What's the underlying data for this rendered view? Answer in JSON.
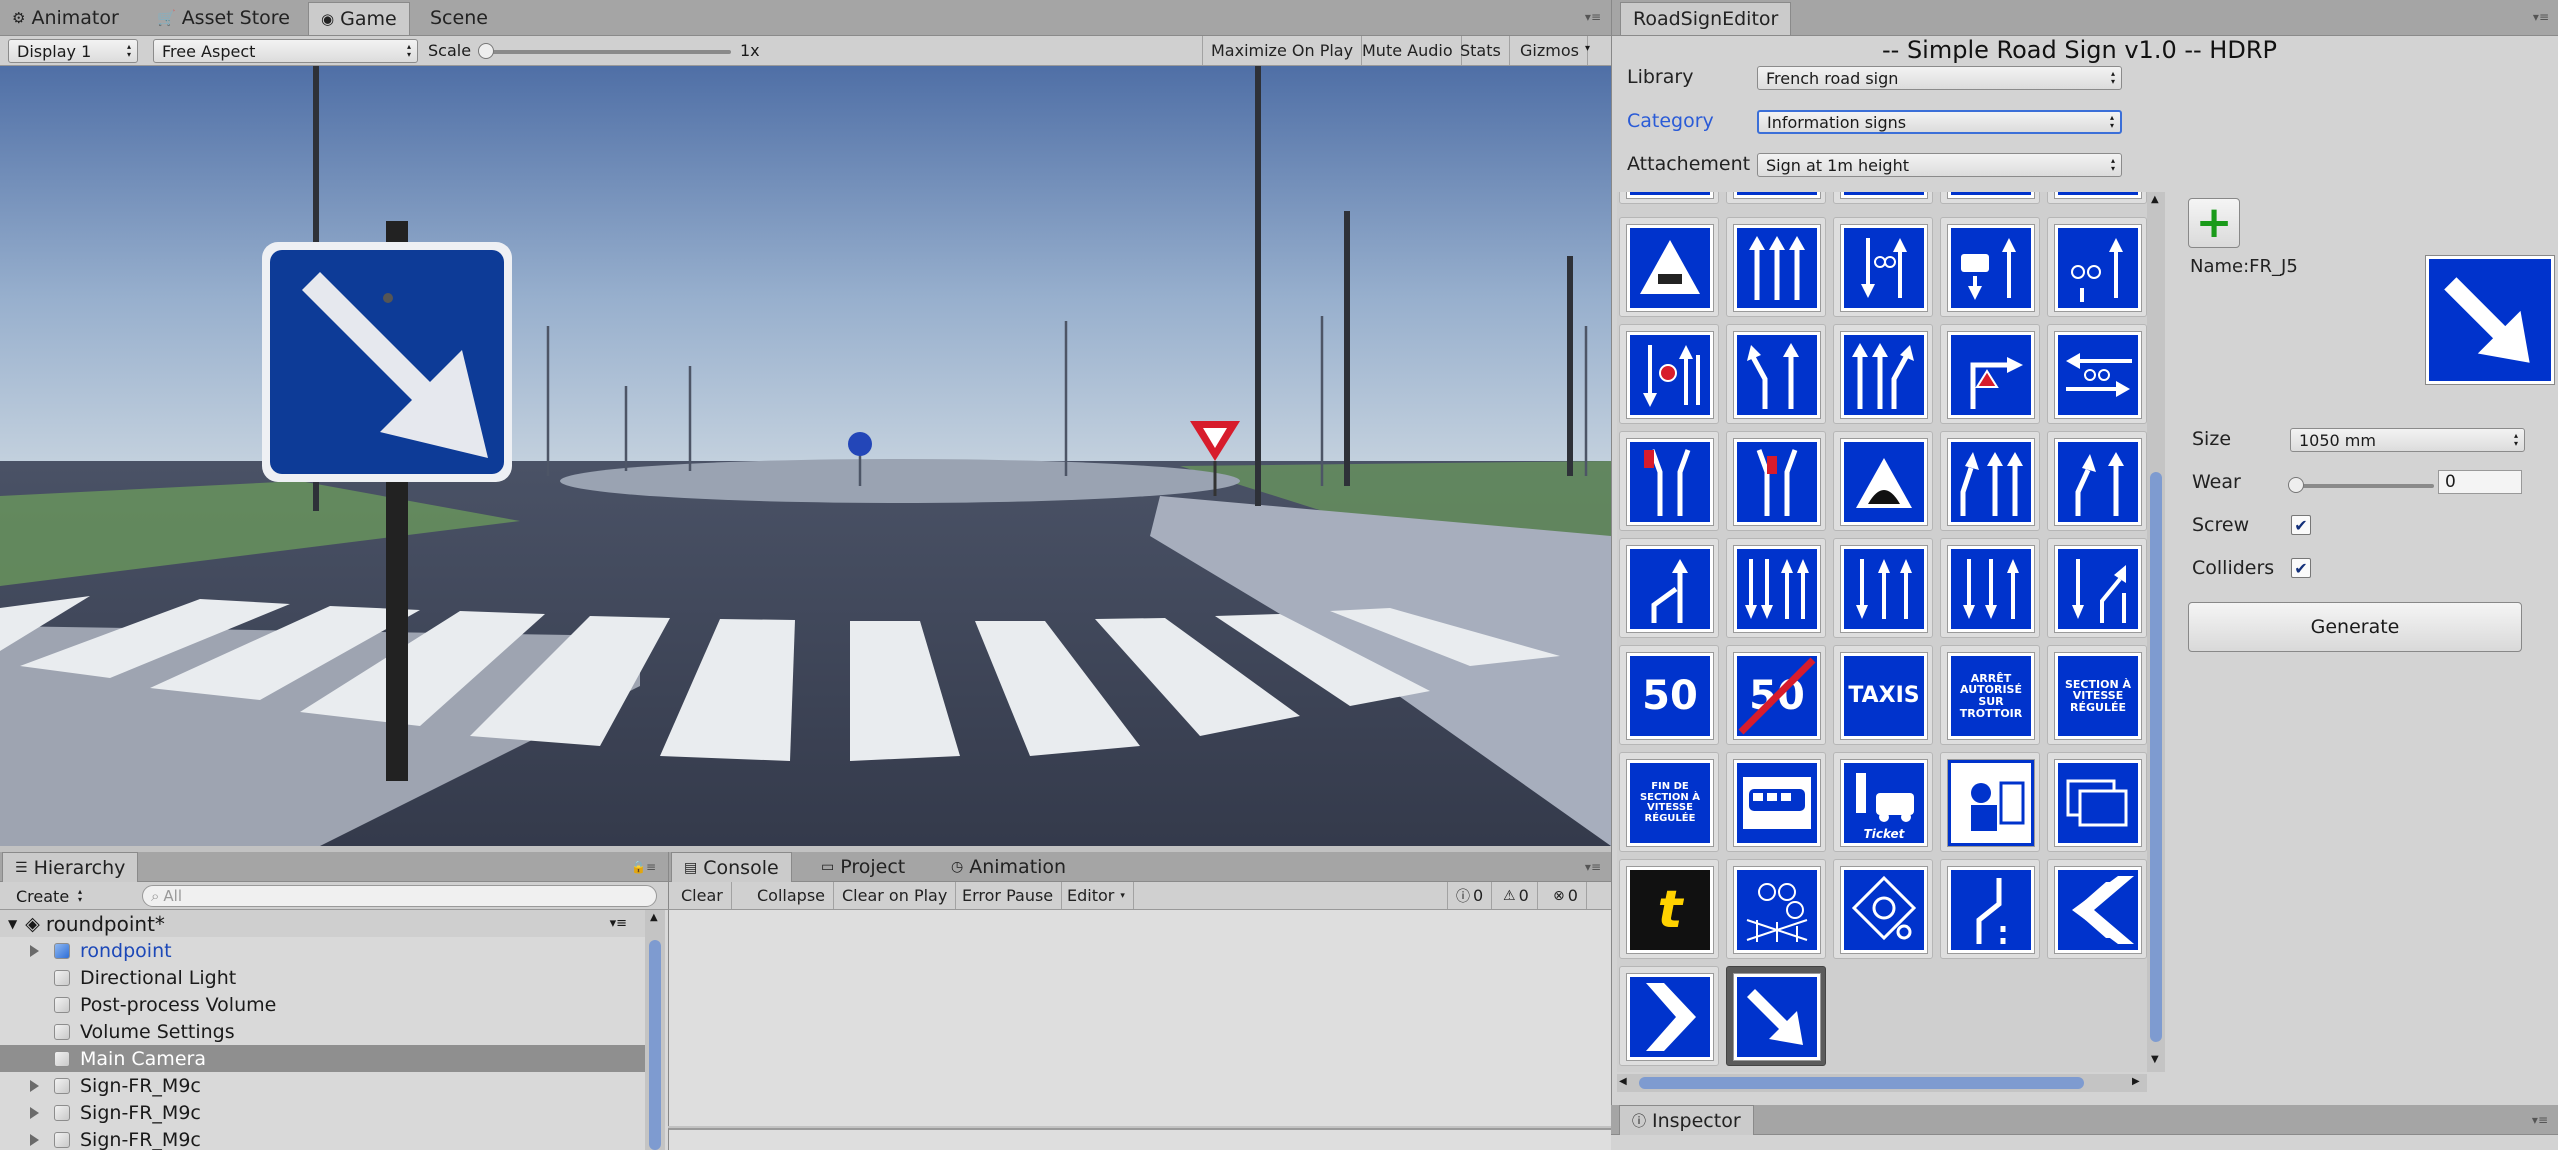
{
  "top_tabs": [
    "Animator",
    "Asset Store",
    "Game",
    "Scene"
  ],
  "game_toolbar": {
    "display": "Display 1",
    "aspect": "Free Aspect",
    "scale_label": "Scale",
    "scale_value": "1x",
    "maximize": "Maximize On Play",
    "mute": "Mute Audio",
    "stats": "Stats",
    "gizmos": "Gizmos"
  },
  "editor": {
    "tab": "RoadSignEditor",
    "title": "-- Simple Road Sign v1.0 -- HDRP",
    "library_label": "Library",
    "library_value": "French road sign",
    "category_label": "Category",
    "category_value": "Information signs",
    "attach_label": "Attachement",
    "attach_value": "Sign at 1m height",
    "name": "Name:FR_J5",
    "size_label": "Size",
    "size_value": "1050 mm",
    "wear_label": "Wear",
    "wear_value": "0",
    "screw_label": "Screw",
    "colliders_label": "Colliders",
    "generate": "Generate",
    "screw_checked": true,
    "colliders_checked": true
  },
  "sign_texts": {
    "s50": "50",
    "s50b": "50",
    "taxis": "TAXIS",
    "arret": "ARRÊT AUTORISÉ SUR TROTTOIR",
    "section": "SECTION À VITESSE RÉGULÉE",
    "fin": "FIN DE SECTION À VITESSE RÉGULÉE",
    "ticket": "Ticket",
    "t": "t"
  },
  "hierarchy": {
    "tab": "Hierarchy",
    "create": "Create",
    "search_placeholder": "All",
    "scene": "roundpoint*",
    "items": [
      "rondpoint",
      "Directional Light",
      "Post-process Volume",
      "Volume Settings",
      "Main Camera",
      "Sign-FR_M9c",
      "Sign-FR_M9c",
      "Sign-FR_M9c"
    ]
  },
  "console": {
    "tabs": [
      "Console",
      "Project",
      "Animation"
    ],
    "buttons": [
      "Clear",
      "Collapse",
      "Clear on Play",
      "Error Pause",
      "Editor"
    ],
    "counts": [
      "0",
      "0",
      "0"
    ]
  },
  "inspector": {
    "tab": "Inspector"
  },
  "colors": {
    "sign_blue": "#0033cc",
    "accent": "#2a5bd7"
  }
}
